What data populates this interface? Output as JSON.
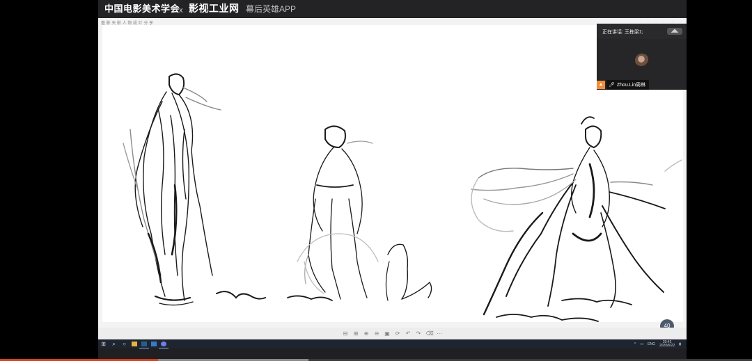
{
  "banner": {
    "left_title": "中国电影美术学会",
    "separator": "x",
    "main_title": "影视工业网",
    "subtitle": "幕后英雄APP"
  },
  "document": {
    "header_text": "藝 影 天 影 人 物 設 計 分 享",
    "zoom_badge": "40"
  },
  "pip": {
    "speaker_label": "正在讲话: 王栋梁1;",
    "participant_name": "Zhou.Lin周林",
    "person_icon": "person-icon",
    "mic_icon": "microphone-icon"
  },
  "toolbar": {
    "icons": [
      "zoom-out-icon",
      "zoom-in-icon",
      "magnify-icon",
      "search-icon",
      "fit-icon",
      "rotate-icon",
      "undo-icon",
      "redo-icon",
      "delete-icon",
      "more-icon"
    ]
  },
  "taskbar": {
    "icons": [
      "windows-start-icon",
      "search-icon",
      "task-view-icon"
    ],
    "apps": [
      "file-explorer-app",
      "photoshop-app",
      "ppt-app",
      "meeting-app"
    ],
    "tray": {
      "language": "ENG",
      "time": "20:42",
      "date": "2020/6/22"
    }
  },
  "video_progress": {
    "played_fraction": 0.21,
    "buffered_fraction": 0.41
  },
  "colors": {
    "progress_fill": "#d44020",
    "zoom_badge": "#4c5a6a",
    "person_icon": "#f28c38"
  }
}
